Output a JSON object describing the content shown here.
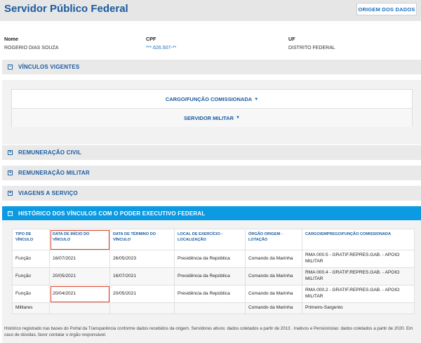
{
  "header": {
    "title": "Servidor Público Federal",
    "origem_button": "ORIGEM DOS DADOS"
  },
  "person": {
    "nome_label": "Nome",
    "nome_value": "ROGERIO DIAS SOUZA",
    "cpf_label": "CPF",
    "cpf_value": "***.626.507-**",
    "uf_label": "UF",
    "uf_value": "DISTRITO FEDERAL"
  },
  "sections": {
    "vinculos": "VÍNCULOS VIGENTES",
    "remun_civil": "REMUNERAÇÃO CIVIL",
    "remun_militar": "REMUNERAÇÃO MILITAR",
    "viagens": "VIAGENS A SERVIÇO",
    "historico": "HISTÓRICO DOS VÍNCULOS COM O PODER EXECUTIVO FEDERAL"
  },
  "vinculos_panel": {
    "row1": "CARGO/FUNÇÃO COMISSIONADA",
    "row2": "SERVIDOR MILITAR"
  },
  "table": {
    "headers": [
      "TIPO DE VÍNCULO",
      "DATA DE INÍCIO DO VÍNCULO",
      "DATA DE TÉRMINO DO VÍNCULO",
      "LOCAL DE EXERCÍCIO - LOCALIZAÇÃO",
      "ÓRGÃO ORIGEM - LOTAÇÃO",
      "CARGO/EMPREGO/FUNÇÃO COMISSIONADA"
    ],
    "rows": [
      [
        "Função",
        "16/07/2021",
        "26/05/2023",
        "Presidência da República",
        "Comando da Marinha",
        "RMA 000.5 - GRATIF.REPRES.GAB. - APOIO MILITAR"
      ],
      [
        "Função",
        "20/05/2021",
        "16/07/2021",
        "Presidência da República",
        "Comando da Marinha",
        "RMA 000.4 - GRATIF.REPRES.GAB. - APOIO MILITAR"
      ],
      [
        "Função",
        "20/04/2021",
        "20/05/2021",
        "Presidência da República",
        "Comando da Marinha",
        "RMA 000.2 - GRATIF.REPRES.GAB. - APOIO MILITAR"
      ],
      [
        "Militares",
        "",
        "",
        "",
        "Comando da Marinha",
        "Primeiro-Sargento"
      ]
    ]
  },
  "footnote": "Histórico registrado nas bases do Portal da Transparência conforme dados recebidos da origem. Servidores ativos: dados coletados a partir de 2013 . Inativos e Pensionistas: dados coletados a partir de 2020. Em caso de dúvidas, favor contatar o órgão responsável."
}
